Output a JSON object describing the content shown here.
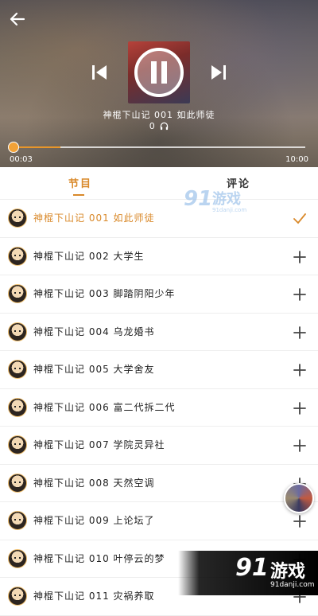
{
  "player": {
    "track_title": "神棍下山记 001 如此师徒",
    "listen_count": "0",
    "time_current": "00:03",
    "time_total": "10:00",
    "progress": 0.005,
    "accent": "#e8962a"
  },
  "tabs": [
    {
      "label": "节目",
      "active": true
    },
    {
      "label": "评论",
      "active": false
    }
  ],
  "programs": [
    {
      "label": "神棍下山记 001 如此师徒",
      "action": "check-icon",
      "active": true
    },
    {
      "label": "神棍下山记 002 大学生",
      "action": "plus-icon",
      "active": false
    },
    {
      "label": "神棍下山记 003 脚踏阴阳少年",
      "action": "plus-icon",
      "active": false
    },
    {
      "label": "神棍下山记 004 乌龙婚书",
      "action": "plus-icon",
      "active": false
    },
    {
      "label": "神棍下山记 005 大学舍友",
      "action": "plus-icon",
      "active": false
    },
    {
      "label": "神棍下山记 006 富二代拆二代",
      "action": "plus-icon",
      "active": false
    },
    {
      "label": "神棍下山记 007 学院灵异社",
      "action": "plus-icon",
      "active": false
    },
    {
      "label": "神棍下山记 008 天然空调",
      "action": "plus-icon",
      "active": false
    },
    {
      "label": "神棍下山记 009 上论坛了",
      "action": "plus-icon",
      "active": false
    },
    {
      "label": "神棍下山记 010 叶停云的梦",
      "action": "plus-icon",
      "active": false
    },
    {
      "label": "神棍下山记 011 灾祸养取",
      "action": "plus-icon",
      "active": false
    }
  ],
  "watermark": {
    "number": "91",
    "text": "游戏",
    "url": "91danji.com"
  }
}
